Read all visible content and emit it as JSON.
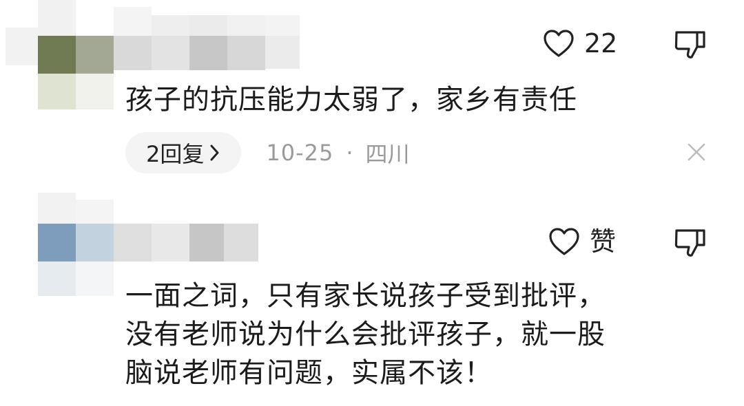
{
  "comments": [
    {
      "like_count": "22",
      "text": "孩子的抗压能力太弱了，家乡有责任",
      "reply_label": "2回复",
      "date": "10-25",
      "separator": "·",
      "location": "四川",
      "icons": [
        "heart-icon",
        "thumbs-down-icon",
        "chevron-right-icon",
        "close-icon"
      ]
    },
    {
      "like_label": "赞",
      "text": "一面之词，只有家长说孩子受到批评，\n没有老师说为什么会批评孩子，就一股\n脑说老师有问题，实属不该！",
      "icons": [
        "heart-icon",
        "thumbs-down-icon"
      ]
    }
  ],
  "colors": {
    "text": "#1b1b1b",
    "meta": "#9a9a9a",
    "pill_bg": "#f4f4f4",
    "icon": "#222222"
  }
}
